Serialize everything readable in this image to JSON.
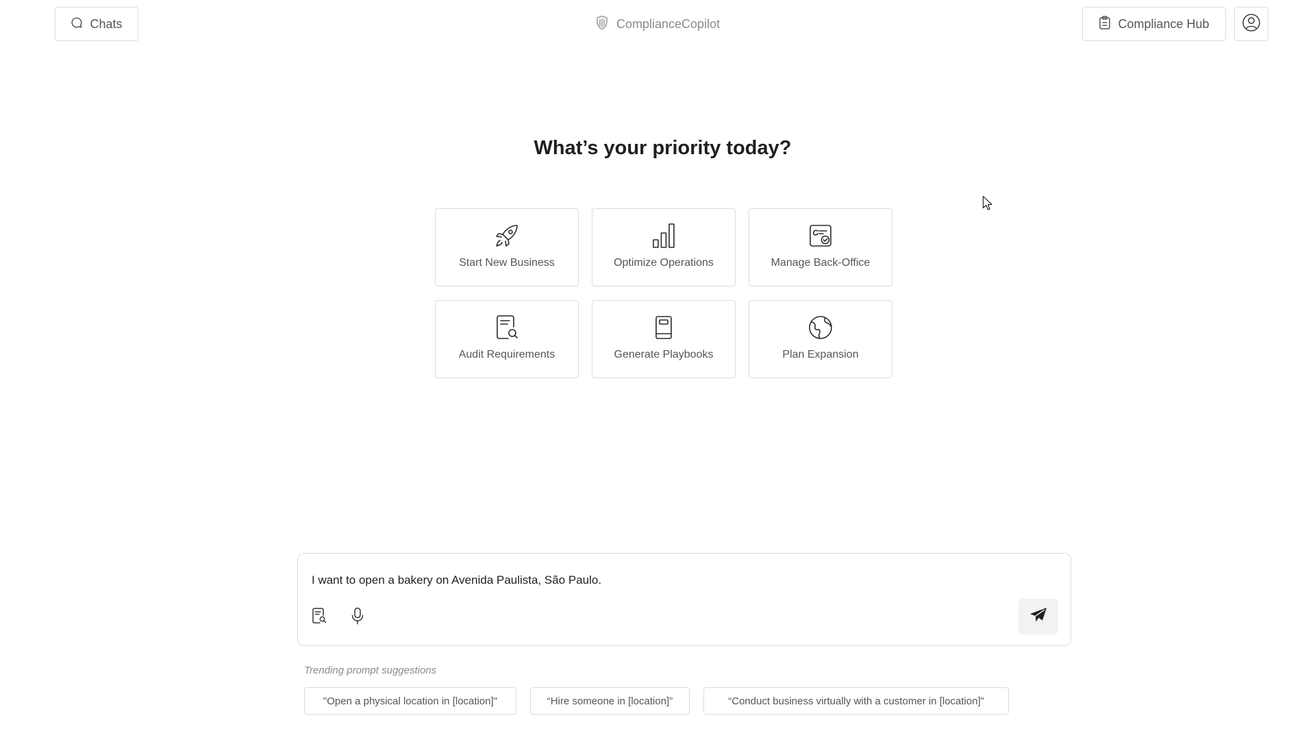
{
  "header": {
    "chats_label": "Chats",
    "brand_name": "ComplianceCopilot",
    "hub_label": "Compliance Hub",
    "icons": {
      "chats": "chat-bubble-icon",
      "brand": "shield-icon",
      "hub": "clipboard-icon",
      "profile": "user-circle-icon"
    }
  },
  "main": {
    "headline": "What’s your priority today?",
    "cards": [
      {
        "label": "Start New Business",
        "icon": "rocket-icon"
      },
      {
        "label": "Optimize Operations",
        "icon": "bar-chart-icon"
      },
      {
        "label": "Manage Back-Office",
        "icon": "office-check-icon"
      },
      {
        "label": "Audit Requirements",
        "icon": "document-search-icon"
      },
      {
        "label": "Generate Playbooks",
        "icon": "book-icon"
      },
      {
        "label": "Plan Expansion",
        "icon": "globe-icon"
      }
    ]
  },
  "composer": {
    "value": "I want to open a bakery on Avenida Paulista, São Paulo.",
    "icons": {
      "search": "document-search-icon",
      "mic": "microphone-icon",
      "send": "send-icon"
    }
  },
  "suggestions": {
    "title": "Trending prompt suggestions",
    "items": [
      "\"Open a physical location in [location]\"",
      "“Hire someone in [location]”",
      "“Conduct business virtually with a customer in [location]”"
    ]
  },
  "colors": {
    "border": "#dcdcdc",
    "text_primary": "#1f1f1f",
    "text_secondary": "#555555",
    "muted": "#8a8a8a",
    "send_bg": "#f2f2f2"
  }
}
